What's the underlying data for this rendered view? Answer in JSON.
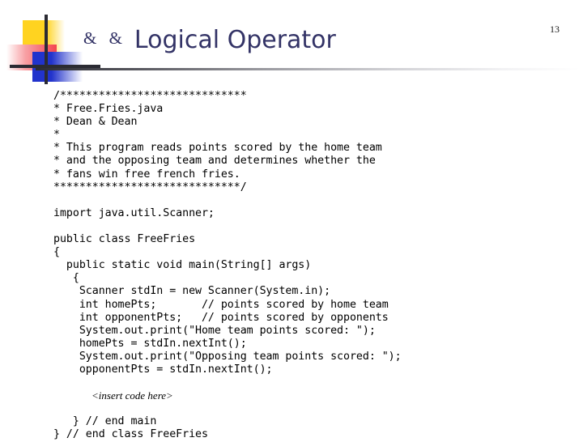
{
  "slide": {
    "page_number": "13",
    "title_prefix": "& &",
    "title": "Logical Operator",
    "accent_color": "#333366",
    "logo_colors": {
      "yellow": "#FFD320",
      "red": "#F4454F",
      "blue": "#2233CC",
      "cross": "#2B2B33"
    }
  },
  "code": {
    "lines": [
      "/*****************************",
      "* Free.Fries.java",
      "* Dean & Dean",
      "*",
      "* This program reads points scored by the home team",
      "* and the opposing team and determines whether the",
      "* fans win free french fries.",
      "*****************************/",
      "",
      "import java.util.Scanner;",
      "",
      "public class FreeFries",
      "{",
      "  public static void main(String[] args)",
      "   {",
      "    Scanner stdIn = new Scanner(System.in);",
      "    int homePts;       // points scored by home team",
      "    int opponentPts;   // points scored by opponents",
      "    System.out.print(\"Home team points scored: \");",
      "    homePts = stdIn.nextInt();",
      "    System.out.print(\"Opposing team points scored: \");",
      "    opponentPts = stdIn.nextInt();",
      "",
      "@@INSERT@@",
      "",
      "   } // end main",
      "} // end class FreeFries"
    ],
    "insert_note": "<insert code here>"
  }
}
